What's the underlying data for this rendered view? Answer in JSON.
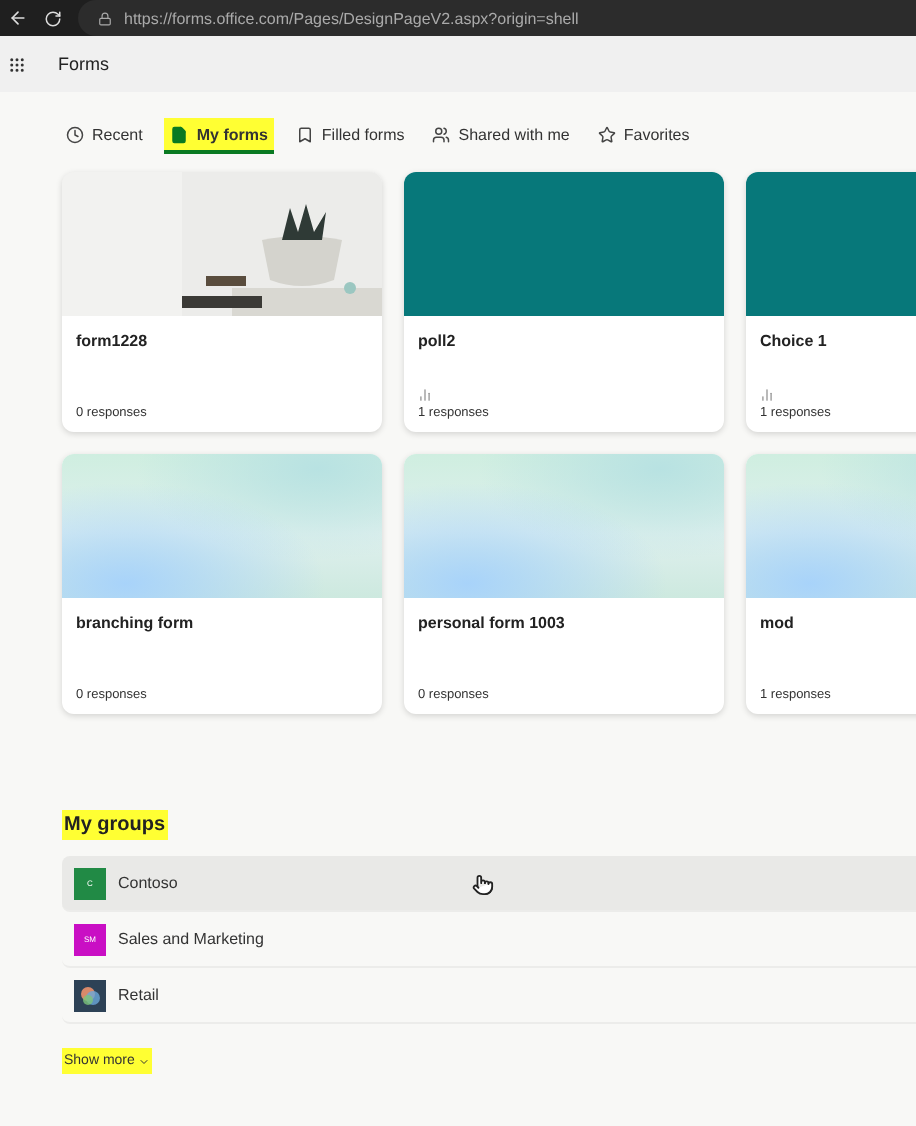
{
  "browser": {
    "url": "https://forms.office.com/Pages/DesignPageV2.aspx?origin=shell"
  },
  "app": {
    "title": "Forms"
  },
  "tabs": [
    {
      "label": "Recent",
      "selected": false,
      "highlighted": false
    },
    {
      "label": "My forms",
      "selected": true,
      "highlighted": true
    },
    {
      "label": "Filled forms",
      "selected": false,
      "highlighted": false
    },
    {
      "label": "Shared with me",
      "selected": false,
      "highlighted": false
    },
    {
      "label": "Favorites",
      "selected": false,
      "highlighted": false
    }
  ],
  "forms": [
    {
      "title": "form1228",
      "kind": "picture",
      "poll": false,
      "responses": "0 responses"
    },
    {
      "title": "poll2",
      "kind": "teal",
      "poll": true,
      "responses": "1 responses"
    },
    {
      "title": "Choice 1",
      "kind": "teal",
      "poll": true,
      "responses": "1 responses"
    },
    {
      "title": "branching form",
      "kind": "gradient",
      "poll": false,
      "responses": "0 responses"
    },
    {
      "title": "personal form 1003",
      "kind": "gradient",
      "poll": false,
      "responses": "0 responses"
    },
    {
      "title": "mod",
      "kind": "gradient",
      "poll": false,
      "responses": "1 responses"
    }
  ],
  "groups": {
    "heading": "My groups",
    "highlighted": true,
    "items": [
      {
        "name": "Contoso",
        "kind": "initials",
        "initials": "C",
        "color": "#218a45",
        "hovered": true
      },
      {
        "name": "Sales and Marketing",
        "kind": "initials",
        "initials": "SM",
        "color": "#c90fc4",
        "hovered": false
      },
      {
        "name": "Retail",
        "kind": "logo",
        "color": "#2d4256",
        "hovered": false
      }
    ],
    "show_more": {
      "label": "Show more",
      "highlighted": true
    }
  }
}
